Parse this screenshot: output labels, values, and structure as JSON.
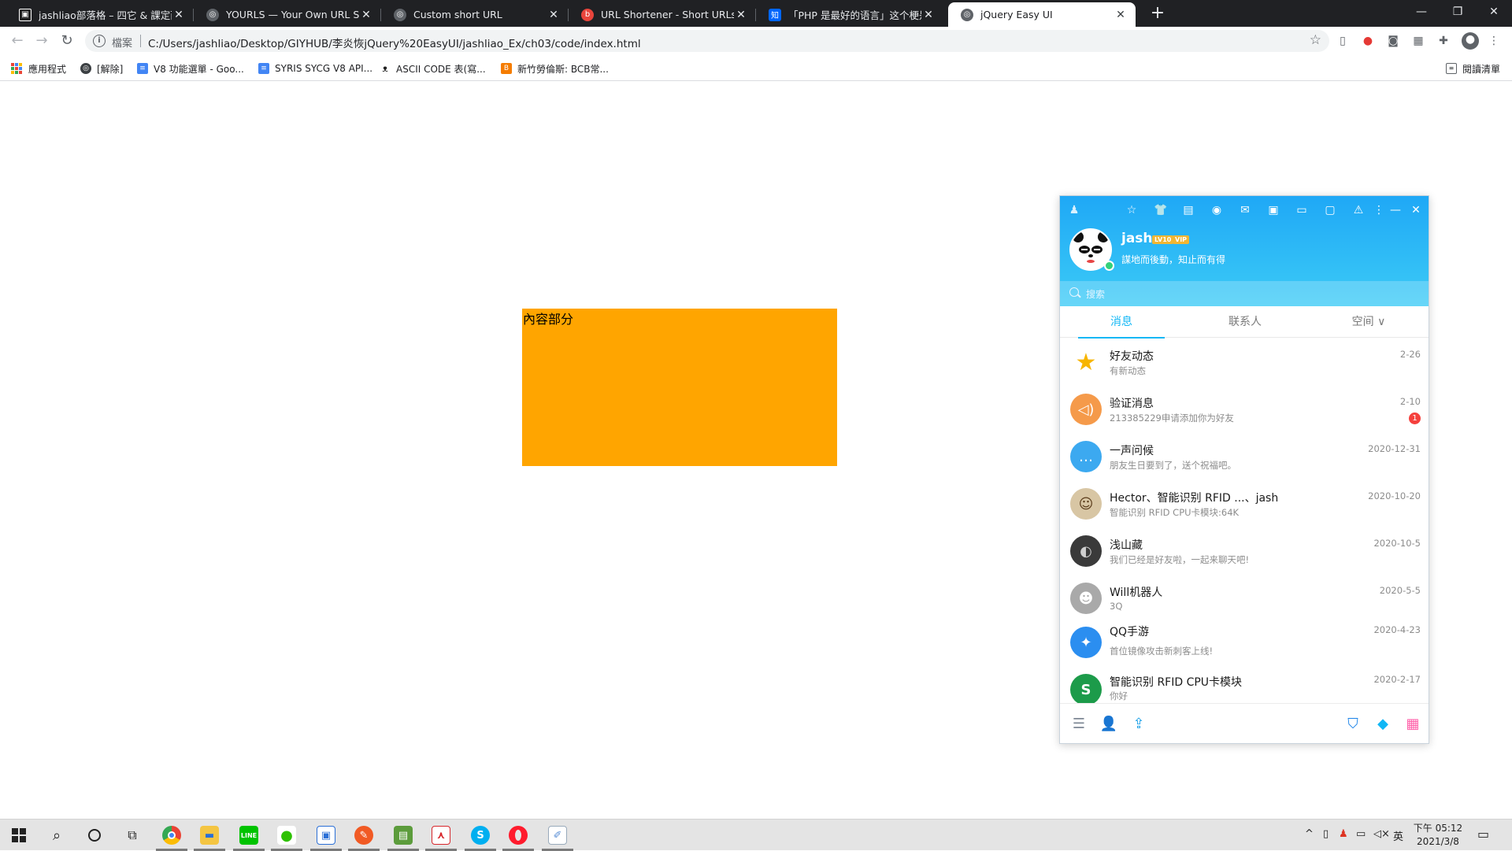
{
  "browser": {
    "tabs": [
      {
        "title": "jashliao部落格 – 四它 & 課定而後",
        "favicon_color": "#222222",
        "favicon_glyph": "▣"
      },
      {
        "title": "YOURLS — Your Own URL Shor",
        "favicon_color": "#5f6368",
        "favicon_glyph": "◎"
      },
      {
        "title": "Custom short URL",
        "favicon_color": "#5f6368",
        "favicon_glyph": "◎"
      },
      {
        "title": "URL Shortener - Short URLs & C",
        "favicon_color": "#e8453c",
        "favicon_glyph": "b"
      },
      {
        "title": "「PHP 是最好的语言」这个梗是",
        "favicon_color": "#0066ff",
        "favicon_glyph": "知"
      },
      {
        "title": "jQuery Easy UI",
        "favicon_color": "#5f6368",
        "favicon_glyph": "◎",
        "active": true
      }
    ],
    "new_tab_glyph": "+",
    "window_controls": {
      "minimize": "—",
      "restore": "❐",
      "close": "✕"
    },
    "omnibox": {
      "scheme_label": "檔案",
      "url": "C:/Users/jashliao/Desktop/GIYHUB/李炎恢jQuery%20EasyUI/jashliao_Ex/ch03/code/index.html"
    },
    "bookmarks": [
      {
        "label": "應用程式",
        "icon": "apps-grid-icon"
      },
      {
        "label": "[解除]",
        "icon": "globe-icon",
        "color": "#3c4043"
      },
      {
        "label": "V8 功能選單 - Goo...",
        "icon": "docs-icon",
        "color": "#4285f4"
      },
      {
        "label": "SYRIS SYCG V8 API...",
        "icon": "docs-icon",
        "color": "#4285f4"
      },
      {
        "label": "ASCII CODE 表(寫...",
        "icon": "panda-icon",
        "color": "#3c4043"
      },
      {
        "label": "新竹勞倫斯: BCB常...",
        "icon": "blogger-icon",
        "color": "#f57c00"
      }
    ],
    "reading_list": "閱讀清單"
  },
  "page": {
    "content_text": "內容部分",
    "content_color": "#ffa500"
  },
  "qq": {
    "name": "jash",
    "level_badge": "LV10",
    "vip_badge": "VIP",
    "signature": "謀地而後動，知止而有得",
    "search_placeholder": "搜索",
    "tabs": [
      "消息",
      "联系人",
      "空间 ∨"
    ],
    "conversations": [
      {
        "name": "好友动态",
        "preview": "有新动态",
        "date": "2-26",
        "avatar_color": "#ffffff",
        "avatar_glyph": "★",
        "glyph_color": "#f7b500"
      },
      {
        "name": "验证消息",
        "preview": "213385229申请添加你为好友",
        "date": "2-10",
        "unread": "1",
        "avatar_color": "#f59a4a",
        "avatar_glyph": "🔊",
        "glyph_color": "#ffffff"
      },
      {
        "name": "一声问候",
        "preview": "朋友生日要到了，送个祝福吧。",
        "date": "2020-12-31",
        "avatar_color": "#3ca9f0",
        "avatar_glyph": "💬",
        "glyph_color": "#ffffff"
      },
      {
        "name": "Hector、智能识别 RFID ...、jash",
        "preview": "智能识别 RFID CPU卡模块:64K",
        "date": "2020-10-20",
        "avatar_color": "#d8c6a4",
        "avatar_glyph": "☺",
        "glyph_color": "#5a3b1a"
      },
      {
        "name": "浅山藏",
        "preview": "我们已经是好友啦，一起来聊天吧!",
        "date": "2020-10-5",
        "avatar_color": "#3a3a3a",
        "avatar_glyph": "◐",
        "glyph_color": "#cfcfcf"
      },
      {
        "name": "Will机器人",
        "preview": "3Q",
        "date": "2020-5-5",
        "avatar_color": "#a9a9a9",
        "avatar_glyph": "☻",
        "glyph_color": "#ffffff"
      },
      {
        "name": "QQ手游",
        "preview": "首位镜像攻击新刺客上线!",
        "date": "2020-4-23",
        "avatar_color": "#2b8ef0",
        "avatar_glyph": "✦",
        "glyph_color": "#ffffff"
      },
      {
        "name": "智能识别 RFID CPU卡模块",
        "preview": "你好",
        "date": "2020-2-17",
        "avatar_color": "#1c9b4a",
        "avatar_glyph": "S",
        "glyph_color": "#ffffff"
      }
    ]
  },
  "taskbar": {
    "ime": "英",
    "time": "下午 05:12",
    "date": "2021/3/8"
  }
}
